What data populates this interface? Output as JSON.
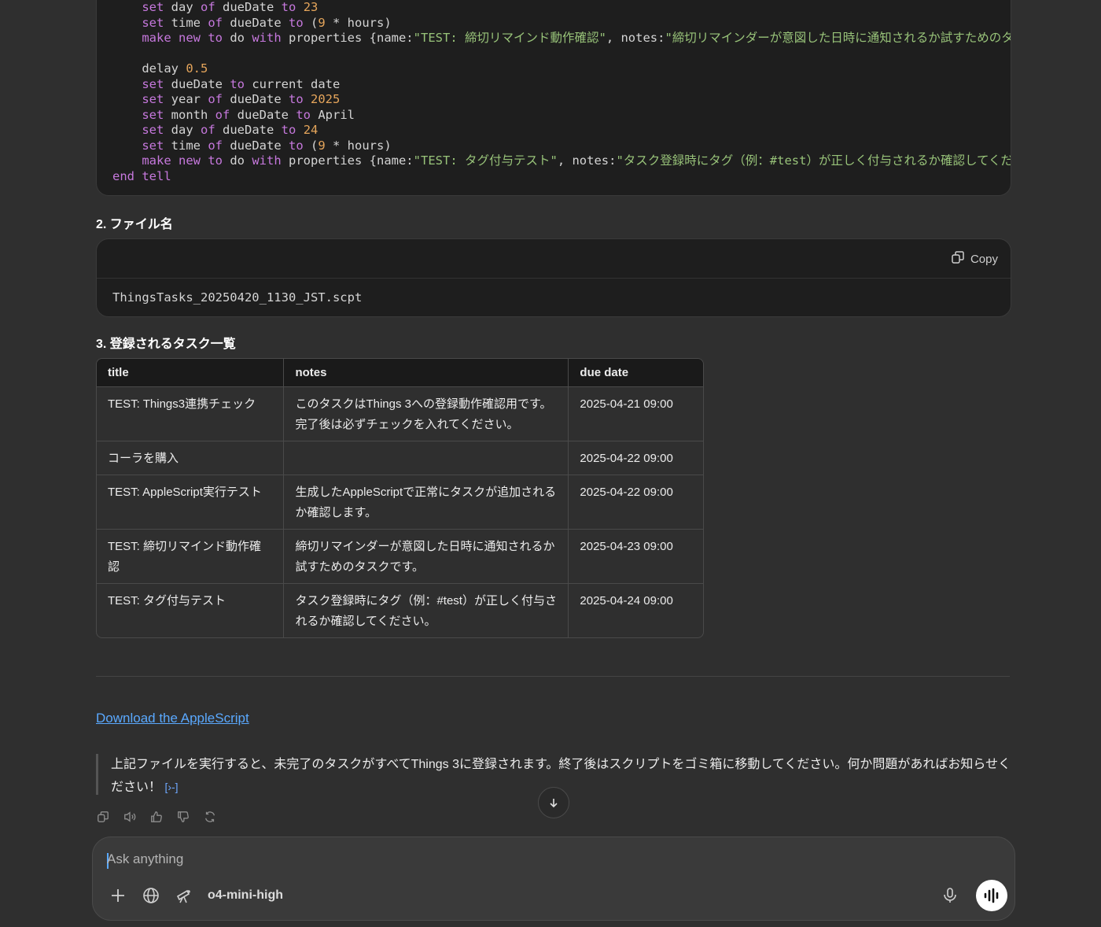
{
  "code_lines": [
    "    set day of dueDate to 23",
    "    set time of dueDate to (9 * hours)",
    "    make new to do with properties {name:\"TEST: 締切リマインド動作確認\", notes:\"締切リマインダーが意図した日時に通知されるか試すためのタ",
    "",
    "    delay 0.5",
    "    set dueDate to current date",
    "    set year of dueDate to 2025",
    "    set month of dueDate to April",
    "    set day of dueDate to 24",
    "    set time of dueDate to (9 * hours)",
    "    make new to do with properties {name:\"TEST: タグ付与テスト\", notes:\"タスク登録時にタグ（例：#test）が正しく付与されるか確認してくださ",
    "end tell"
  ],
  "section2": {
    "heading": "2. ファイル名",
    "copy_label": "Copy",
    "filename": "ThingsTasks_20250420_1130_JST.scpt"
  },
  "section3": {
    "heading": "3. 登録されるタスク一覧",
    "columns": [
      "title",
      "notes",
      "due date"
    ],
    "rows": [
      {
        "title": "TEST: Things3連携チェック",
        "notes": "このタスクはThings 3への登録動作確認用です。完了後は必ずチェックを入れてください。",
        "due": "2025-04-21 09:00"
      },
      {
        "title": "コーラを購入",
        "notes": "",
        "due": "2025-04-22 09:00"
      },
      {
        "title": "TEST: AppleScript実行テスト",
        "notes": "生成したAppleScriptで正常にタスクが追加されるか確認します。",
        "due": "2025-04-22 09:00"
      },
      {
        "title": "TEST: 締切リマインド動作確認",
        "notes": "締切リマインダーが意図した日時に通知されるか試すためのタスクです。",
        "due": "2025-04-23 09:00"
      },
      {
        "title": "TEST: タグ付与テスト",
        "notes": "タスク登録時にタグ（例：#test）が正しく付与されるか確認してください。",
        "due": "2025-04-24 09:00"
      }
    ]
  },
  "download_link": "Download the AppleScript",
  "quote_text": "上記ファイルを実行すると、未完了のタスクがすべてThings 3に登録されます。終了後はスクリプトをゴミ箱に移動してください。何か問題があればお知らせください！",
  "citation_mark": "[›-]",
  "composer": {
    "placeholder": "Ask anything",
    "model": "o4-mini-high"
  },
  "colors": {
    "background": "#2f2f2f",
    "code_bg": "#1e1e1e",
    "keyword": "#c678dd",
    "number": "#e5a55b",
    "string": "#98c379",
    "link": "#5aa9ff"
  }
}
